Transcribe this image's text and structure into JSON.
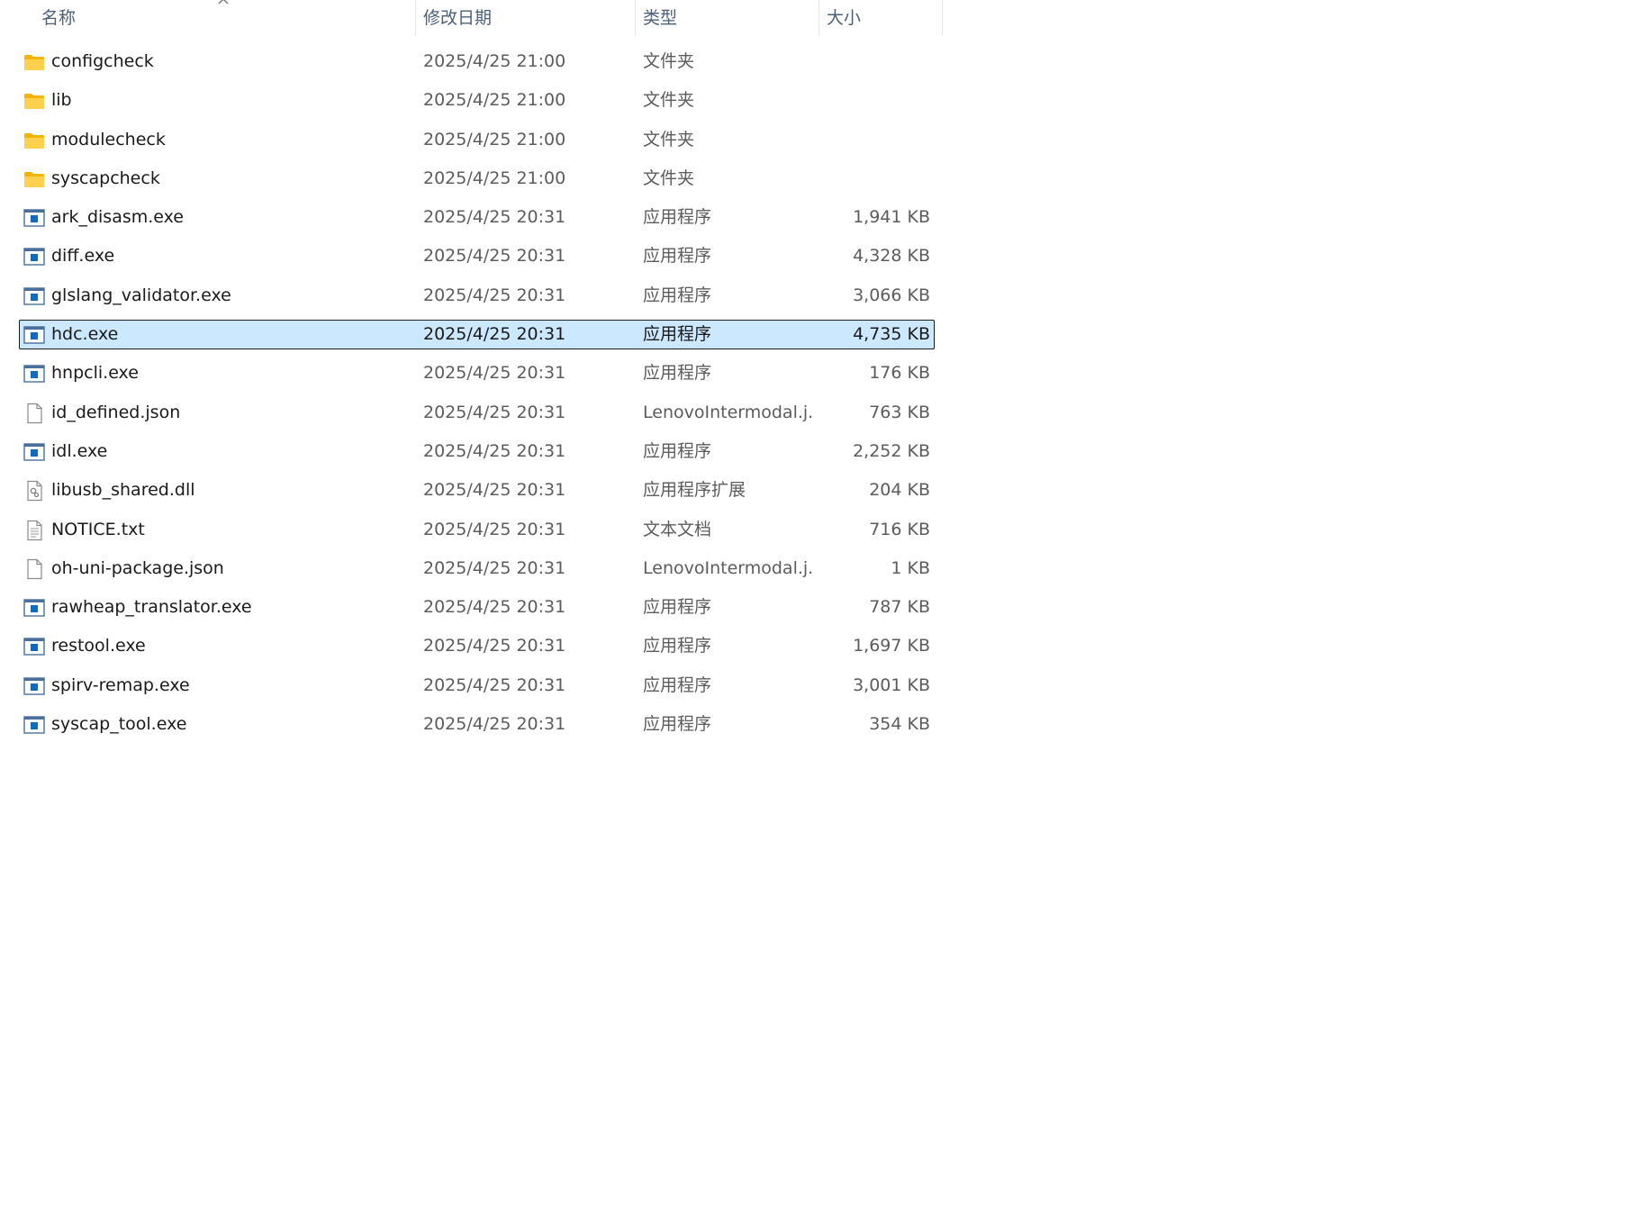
{
  "columns": {
    "name": "名称",
    "date": "修改日期",
    "type": "类型",
    "size": "大小"
  },
  "files": [
    {
      "name": "configcheck",
      "date": "2025/4/25 21:00",
      "type": "文件夹",
      "size": "",
      "icon": "folder-icon"
    },
    {
      "name": "lib",
      "date": "2025/4/25 21:00",
      "type": "文件夹",
      "size": "",
      "icon": "folder-icon"
    },
    {
      "name": "modulecheck",
      "date": "2025/4/25 21:00",
      "type": "文件夹",
      "size": "",
      "icon": "folder-icon"
    },
    {
      "name": "syscapcheck",
      "date": "2025/4/25 21:00",
      "type": "文件夹",
      "size": "",
      "icon": "folder-icon"
    },
    {
      "name": "ark_disasm.exe",
      "date": "2025/4/25 20:31",
      "type": "应用程序",
      "size": "1,941 KB",
      "icon": "exe-icon"
    },
    {
      "name": "diff.exe",
      "date": "2025/4/25 20:31",
      "type": "应用程序",
      "size": "4,328 KB",
      "icon": "exe-icon"
    },
    {
      "name": "glslang_validator.exe",
      "date": "2025/4/25 20:31",
      "type": "应用程序",
      "size": "3,066 KB",
      "icon": "exe-icon"
    },
    {
      "name": "hdc.exe",
      "date": "2025/4/25 20:31",
      "type": "应用程序",
      "size": "4,735 KB",
      "icon": "exe-icon",
      "selected": true
    },
    {
      "name": "hnpcli.exe",
      "date": "2025/4/25 20:31",
      "type": "应用程序",
      "size": "176 KB",
      "icon": "exe-icon"
    },
    {
      "name": "id_defined.json",
      "date": "2025/4/25 20:31",
      "type": "LenovoIntermodal.j...",
      "size": "763 KB",
      "icon": "file-icon"
    },
    {
      "name": "idl.exe",
      "date": "2025/4/25 20:31",
      "type": "应用程序",
      "size": "2,252 KB",
      "icon": "exe-icon"
    },
    {
      "name": "libusb_shared.dll",
      "date": "2025/4/25 20:31",
      "type": "应用程序扩展",
      "size": "204 KB",
      "icon": "dll-icon"
    },
    {
      "name": "NOTICE.txt",
      "date": "2025/4/25 20:31",
      "type": "文本文档",
      "size": "716 KB",
      "icon": "text-file-icon"
    },
    {
      "name": "oh-uni-package.json",
      "date": "2025/4/25 20:31",
      "type": "LenovoIntermodal.j...",
      "size": "1 KB",
      "icon": "file-icon"
    },
    {
      "name": "rawheap_translator.exe",
      "date": "2025/4/25 20:31",
      "type": "应用程序",
      "size": "787 KB",
      "icon": "exe-icon"
    },
    {
      "name": "restool.exe",
      "date": "2025/4/25 20:31",
      "type": "应用程序",
      "size": "1,697 KB",
      "icon": "exe-icon"
    },
    {
      "name": "spirv-remap.exe",
      "date": "2025/4/25 20:31",
      "type": "应用程序",
      "size": "3,001 KB",
      "icon": "exe-icon"
    },
    {
      "name": "syscap_tool.exe",
      "date": "2025/4/25 20:31",
      "type": "应用程序",
      "size": "354 KB",
      "icon": "exe-icon"
    }
  ],
  "colors": {
    "selection_bg": "#cce8ff",
    "folder": "#ffc83d",
    "exe_blue": "#0f6cbd"
  }
}
